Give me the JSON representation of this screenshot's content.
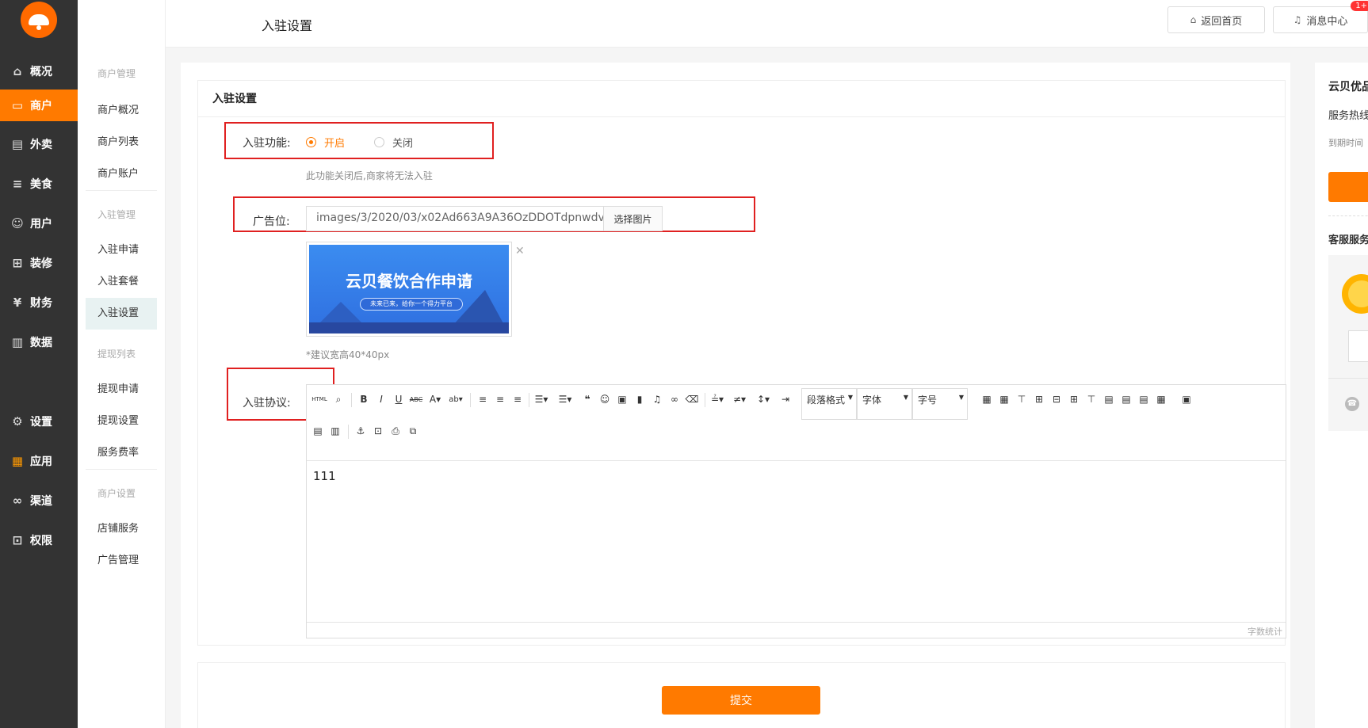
{
  "nav": {
    "items": [
      {
        "label": "概况",
        "icon": "home-icon",
        "glyph": "⌂"
      },
      {
        "label": "商户",
        "icon": "store-icon",
        "glyph": "▭",
        "active": true
      },
      {
        "label": "外卖",
        "icon": "document-icon",
        "glyph": "▤"
      },
      {
        "label": "美食",
        "icon": "menu-icon",
        "glyph": "≡"
      },
      {
        "label": "用户",
        "icon": "user-icon",
        "glyph": "☺"
      },
      {
        "label": "装修",
        "icon": "shop-decor-icon",
        "glyph": "⊞"
      },
      {
        "label": "财务",
        "icon": "wallet-icon",
        "glyph": "¥"
      },
      {
        "label": "数据",
        "icon": "chart-icon",
        "glyph": "▥"
      },
      {
        "label": "设置",
        "icon": "gear-icon",
        "glyph": "⚙"
      },
      {
        "label": "应用",
        "icon": "apps-icon",
        "glyph": "▦"
      },
      {
        "label": "渠道",
        "icon": "link-icon",
        "glyph": "∞"
      },
      {
        "label": "权限",
        "icon": "lock-icon",
        "glyph": "⊡"
      }
    ]
  },
  "subnav": {
    "groups": [
      "商户管理",
      "入驻管理",
      "提现列表",
      "商户设置"
    ],
    "items": [
      "商户概况",
      "商户列表",
      "商户账户",
      "入驻申请",
      "入驻套餐",
      "入驻设置",
      "提现申请",
      "提现设置",
      "服务费率",
      "店铺服务",
      "广告管理"
    ]
  },
  "header": {
    "title": "入驻设置",
    "home_btn": "返回首页",
    "msg_btn": "消息中心",
    "msg_badge": "1+"
  },
  "form": {
    "panel_title": "入驻设置",
    "feature_label": "入驻功能:",
    "radio_on": "开启",
    "radio_off": "关闭",
    "feature_hint": "此功能关闭后,商家将无法入驻",
    "ad_label": "广告位:",
    "ad_value": "images/3/2020/03/x02Ad663A9A36OzDDOTdpnwdv",
    "pick_btn": "选择图片",
    "banner_title": "云贝餐饮合作申请",
    "banner_sub": "未来已来，给你一个得力平台",
    "size_hint": "*建议宽高40*40px",
    "agreement_label": "入驻协议:",
    "editor_content": "111",
    "word_count": "字数统计",
    "toolbar": {
      "html": "HTML",
      "paragraph": "段落格式",
      "font": "字体",
      "size": "字号"
    },
    "submit": "提交"
  },
  "right_panel": {
    "title": "云贝优品",
    "service": "服务热线",
    "expire": "到期时间",
    "support": "客服服务"
  },
  "colors": {
    "accent": "#ff7a00",
    "nav_bg": "#333333",
    "highlight": "#e02020"
  }
}
